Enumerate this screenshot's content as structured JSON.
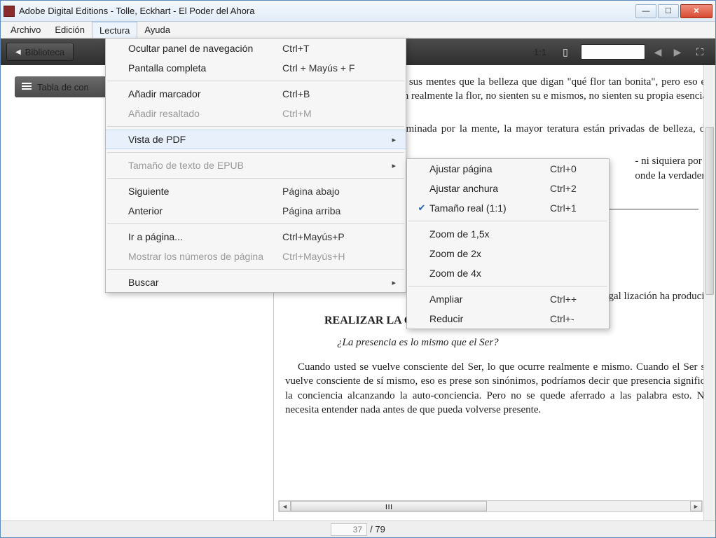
{
  "window": {
    "title": "Adobe Digital Editions - Tolle, Eckhart - El Poder del Ahora"
  },
  "menubar": {
    "items": [
      "Archivo",
      "Edición",
      "Lectura",
      "Ayuda"
    ],
    "openIndex": 2
  },
  "toolbar": {
    "library": "Biblioteca",
    "oneToOne": "1:1"
  },
  "sidebar": {
    "toc": "Tabla de con"
  },
  "menu": {
    "items": [
      {
        "label": "Ocultar panel de navegación",
        "shortcut": "Ctrl+T"
      },
      {
        "label": "Pantalla completa",
        "shortcut": "Ctrl + Mayús + F"
      },
      {
        "sep": true
      },
      {
        "label": "Añadir marcador",
        "shortcut": "Ctrl+B"
      },
      {
        "label": "Añadir resaltado",
        "shortcut": "Ctrl+M",
        "disabled": true
      },
      {
        "sep": true
      },
      {
        "label": "Vista de PDF",
        "submenu": true,
        "hover": true
      },
      {
        "sep": true
      },
      {
        "label": "Tamaño de texto de EPUB",
        "submenu": true,
        "disabled": true
      },
      {
        "sep": true
      },
      {
        "label": "Siguiente",
        "shortcut": "Página abajo"
      },
      {
        "label": "Anterior",
        "shortcut": "Página arriba"
      },
      {
        "sep": true
      },
      {
        "label": "Ir a página...",
        "shortcut": "Ctrl+Mayús+P"
      },
      {
        "label": "Mostrar los números de página",
        "shortcut": "Ctrl+Mayús+H",
        "disabled": true
      },
      {
        "sep": true
      },
      {
        "label": "Buscar",
        "submenu": true
      }
    ]
  },
  "submenu": {
    "items": [
      {
        "label": "Ajustar página",
        "shortcut": "Ctrl+0"
      },
      {
        "label": "Ajustar anchura",
        "shortcut": "Ctrl+2"
      },
      {
        "label": "Tamaño real (1:1)",
        "shortcut": "Ctrl+1",
        "checked": true
      },
      {
        "sep": true
      },
      {
        "label": "Zoom de 1,5x"
      },
      {
        "label": "Zoom de 2x"
      },
      {
        "label": "Zoom de 4x"
      },
      {
        "sep": true
      },
      {
        "label": "Ampliar",
        "shortcut": "Ctrl++"
      },
      {
        "label": "Reducir",
        "shortcut": "Ctrl+-"
      }
    ]
  },
  "content": {
    "p1": "sonas son tan prisioneras de sus mentes que la belleza que digan \"qué flor tan bonita\", pero eso es solamente , presentes, no ven realmente la flor, no sienten su e mismos, no sienten su propia esencia, su santidad.",
    "p2": "os en una cultura tan dominada por la mente, la mayor teratura están privadas de belleza, de esencia interior,",
    "p3a": "- ni siquiera por u",
    "p3b": "onde la verdadera",
    "page_no": "37",
    "p4": "no sólo en las gal lización ha producid",
    "h2": "REALIZAR LA CONCIENCIA PURA",
    "q": "¿La presencia es lo mismo que el Ser?",
    "p5": "Cuando usted se vuelve consciente del Ser, lo que ocurre realmente e mismo. Cuando el Ser se vuelve consciente de sí mismo, eso es prese son sinónimos, podríamos decir que presencia significa la conciencia alcanzando la auto-conciencia. Pero no se quede aferrado a las palabra esto. No necesita entender nada antes de que pueda volverse presente.",
    "scroll_grip": "ııı"
  },
  "status": {
    "current": "37",
    "total": "/ 79"
  }
}
